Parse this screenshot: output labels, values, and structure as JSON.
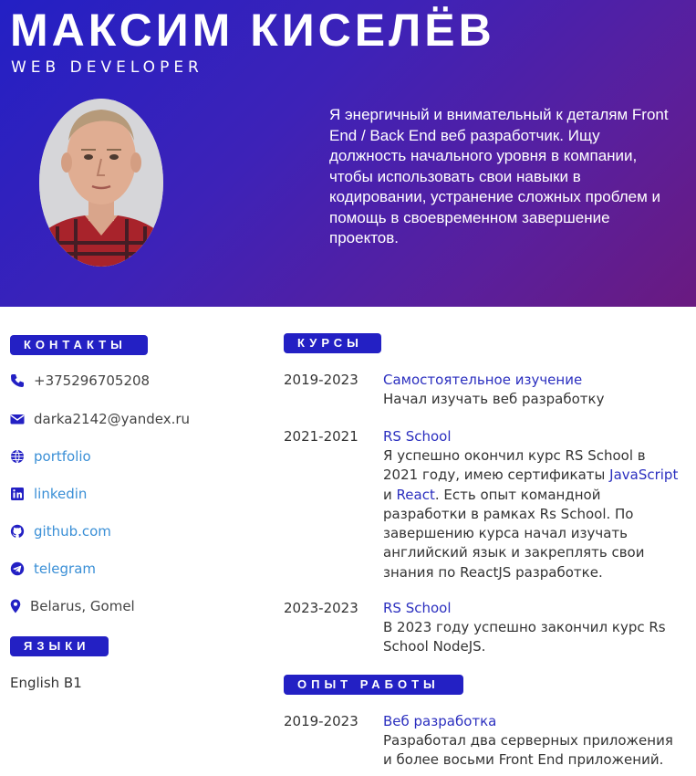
{
  "header": {
    "name": "МАКСИМ КИСЕЛЁВ",
    "role": "WEB DEVELOPER",
    "about": "Я энергичный и внимательный к деталям Front End / Back End веб разработчик. Ищу должность начального уровня в компании, чтобы использовать свои навыки в кодировании, устранение сложных проблем и помощь в своевременном завершение проектов."
  },
  "sections": {
    "contacts": "КОНТАКТЫ",
    "languages": "ЯЗЫКИ",
    "courses": "КУРСЫ",
    "experience": "ОПЫТ РАБОТЫ"
  },
  "contacts": {
    "phone": "+375296705208",
    "email": "darka2142@yandex.ru",
    "portfolio": "portfolio",
    "linkedin": "linkedin",
    "github": "github.com",
    "telegram": "telegram",
    "location": "Belarus, Gomel"
  },
  "languages": [
    "English B1"
  ],
  "courses": [
    {
      "years": "2019-2023",
      "title": "Самостоятельное изучение",
      "desc": "Начал изучать веб разработку"
    },
    {
      "years": "2021-2021",
      "title": "RS School",
      "desc_pre": "Я успешно окончил курс RS School в 2021 году, имею сертификаты ",
      "desc_js": "JavaScript",
      "desc_and": " и ",
      "desc_react": "React",
      "desc_post": ". Есть опыт командной разработки в рамках Rs School. По завершению курса начал изучать английский язык и закреплять свои знания по ReactJS разработке."
    },
    {
      "years": "2023-2023",
      "title": "RS School",
      "desc": "В 2023 году успешно закончил курс Rs School NodeJS."
    }
  ],
  "experience": [
    {
      "years": "2019-2023",
      "title": "Веб разработка",
      "desc": "Разработал два серверных приложения и более восьми Front End приложений."
    }
  ],
  "colors": {
    "accent": "#2320c4",
    "link": "#3a8fd6",
    "title": "#2b2fbf"
  }
}
